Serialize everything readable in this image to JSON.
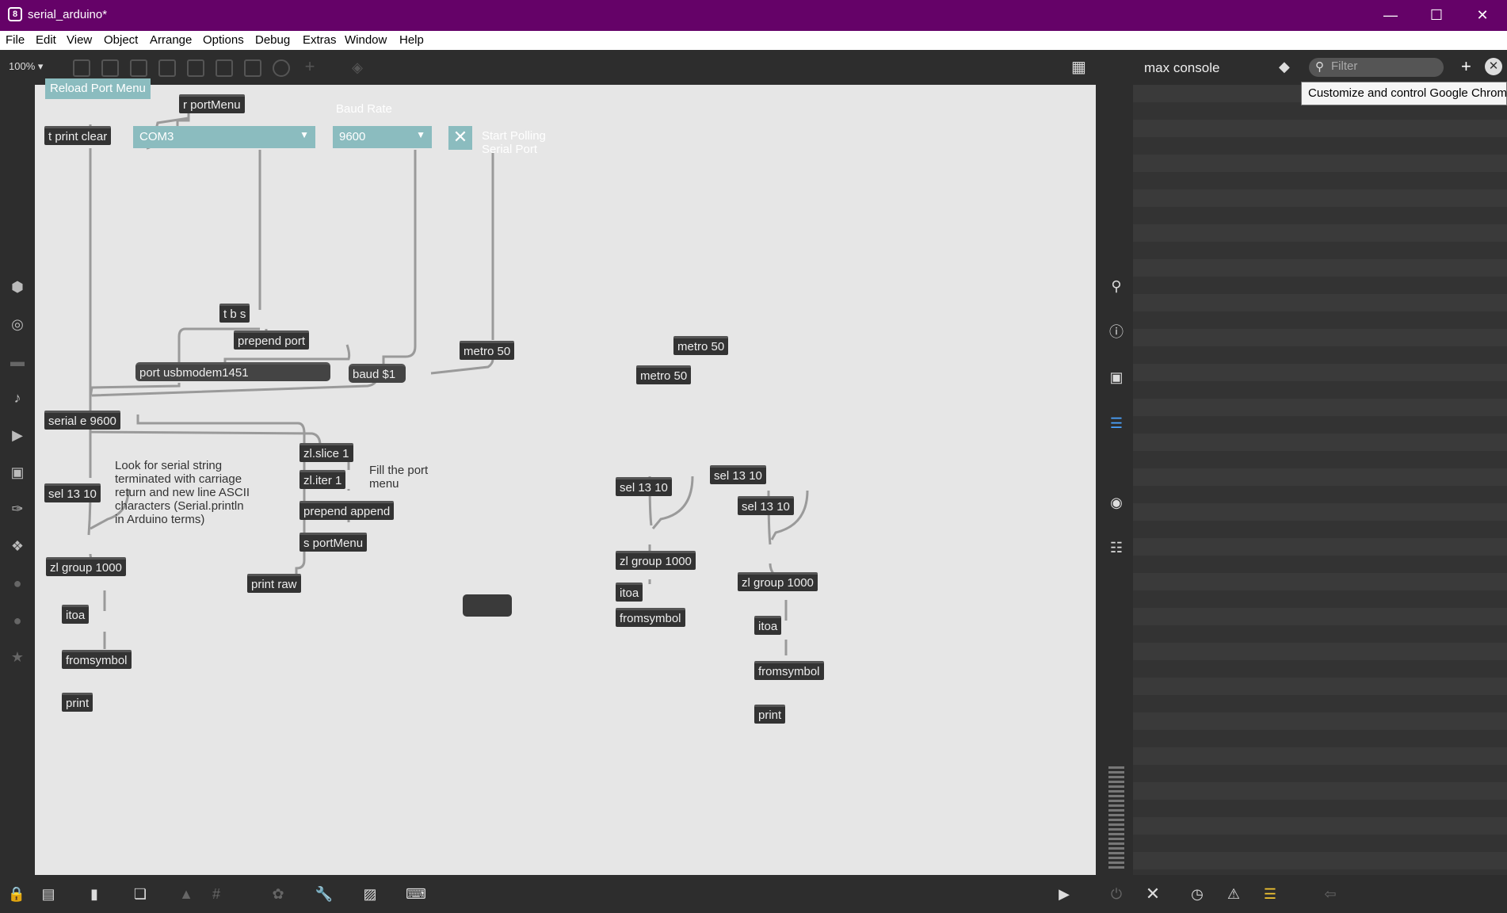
{
  "window": {
    "title": "serial_arduino*",
    "app_icon_glyph": "8",
    "controls": [
      "minimize",
      "maximize",
      "close"
    ]
  },
  "menubar": [
    "File",
    "Edit",
    "View",
    "Object",
    "Arrange",
    "Options",
    "Debug",
    "Extras",
    "Window",
    "Help"
  ],
  "toolbar": {
    "zoom": "100%"
  },
  "patch": {
    "ui": {
      "reload_button": "Reload Port Menu",
      "port_menu": "COM3",
      "baud_label": "Baud Rate",
      "baud_menu": "9600",
      "toggle_label_1": "Start Polling",
      "toggle_label_2": "Serial Port"
    },
    "objects": {
      "r_portmenu": "r portMenu",
      "t_print_clear": "t print clear",
      "tbs": "t b s",
      "prepend_port": "prepend port",
      "port_msg": "port usbmodem1451",
      "baud_msg": "baud $1",
      "metro_a": "metro 50",
      "metro_b": "metro 50",
      "metro_c": "metro 50",
      "serial": "serial e 9600",
      "zlslice": "zl.slice 1",
      "zliter": "zl.iter 1",
      "prepend_append": "prepend append",
      "s_portmenu": "s portMenu",
      "print_raw": "print raw",
      "sel_a": "sel 13 10",
      "zlgroup_a": "zl group 1000",
      "itoa_a": "itoa",
      "fromsymbol_a": "fromsymbol",
      "print_a": "print",
      "sel_b": "sel 13 10",
      "zlgroup_b": "zl group 1000",
      "itoa_b": "itoa",
      "fromsymbol_b": "fromsymbol",
      "sel_c": "sel 13 10",
      "sel_d": "sel 13 10",
      "zlgroup_c": "zl group 1000",
      "itoa_c": "itoa",
      "fromsymbol_c": "fromsymbol",
      "print_c": "print"
    },
    "comments": {
      "fill_port_1": "Fill the port",
      "fill_port_2": "menu",
      "look_1": "Look for serial string",
      "look_2": "terminated with carriage",
      "look_3": "return and new line ASCII",
      "look_4": "characters (Serial.println",
      "look_5": "in Arduino terms)"
    }
  },
  "console": {
    "title": "max console",
    "filter_placeholder": "Filter",
    "tooltip": "Customize and control Google Chrome"
  },
  "colors": {
    "title_bar": "#650268",
    "canvas": "#e6e6e6",
    "ui_object": "#8bbcbf",
    "object_box": "#333333",
    "wire": "#9a9a9a"
  }
}
